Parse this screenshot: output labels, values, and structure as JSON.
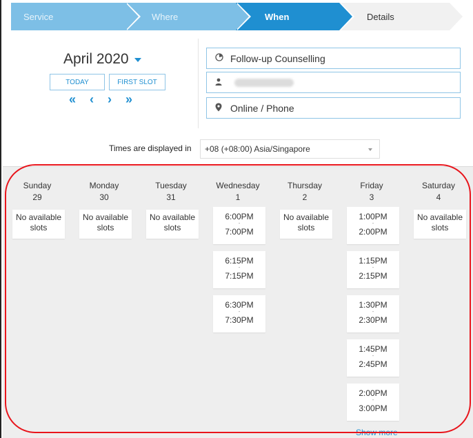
{
  "steps": [
    {
      "label": "Service"
    },
    {
      "label": "Where"
    },
    {
      "label": "When"
    },
    {
      "label": "Details"
    }
  ],
  "header": {
    "month": "April 2020",
    "today": "TODAY",
    "first_slot": "FIRST SLOT",
    "nav": {
      "first": "«",
      "prev": "‹",
      "next": "›",
      "last": "»"
    }
  },
  "fields": {
    "service": "Follow-up Counselling",
    "location": "Online / Phone"
  },
  "timezone": {
    "label": "Times are displayed in",
    "value": "+08 (+08:00) Asia/Singapore"
  },
  "calendar": {
    "days": [
      {
        "name": "Sunday",
        "num": "29",
        "na": "No available slots"
      },
      {
        "name": "Monday",
        "num": "30",
        "na": "No available slots"
      },
      {
        "name": "Tuesday",
        "num": "31",
        "na": "No available slots"
      },
      {
        "name": "Wednesday",
        "num": "1"
      },
      {
        "name": "Thursday",
        "num": "2",
        "na": "No available slots"
      },
      {
        "name": "Friday",
        "num": "3"
      },
      {
        "name": "Saturday",
        "num": "4",
        "na": "No available slots"
      }
    ],
    "wednesday_slots": [
      {
        "start": "6:00PM",
        "end": "7:00PM"
      },
      {
        "start": "6:15PM",
        "end": "7:15PM"
      },
      {
        "start": "6:30PM",
        "end": "7:30PM"
      }
    ],
    "friday_slots": [
      {
        "start": "1:00PM",
        "end": "2:00PM"
      },
      {
        "start": "1:15PM",
        "end": "2:15PM"
      },
      {
        "start": "1:30PM",
        "end": "2:30PM"
      },
      {
        "start": "1:45PM",
        "end": "2:45PM"
      },
      {
        "start": "2:00PM",
        "end": "3:00PM"
      }
    ],
    "show_more": "Show more"
  },
  "colors": {
    "accent": "#1f8fd1",
    "step_inactive": "#7dbfe6",
    "annotation": "#e8141b"
  }
}
